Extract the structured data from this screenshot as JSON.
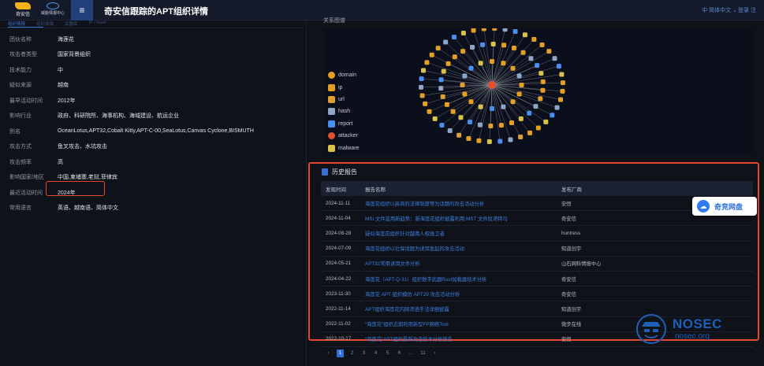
{
  "header": {
    "logo1_text": "奇安信",
    "logo2_text": "威胁情报中心",
    "menu_icon": "≡",
    "title": "奇安信跟踪的APT组织详情",
    "language": "中 简体中文 ⌄",
    "login": "登录 注"
  },
  "tabs": [
    "组织情报",
    "组织画像",
    "武器库",
    "IP / Hash"
  ],
  "profile": {
    "rows": [
      {
        "label": "团伙名称",
        "value": "海莲花"
      },
      {
        "label": "攻击者类型",
        "value": "国家背景组织"
      },
      {
        "label": "技术能力",
        "value": "中"
      },
      {
        "label": "疑似来源",
        "value": "越南"
      },
      {
        "label": "最早活动时间",
        "value": "2012年"
      },
      {
        "label": "影响行业",
        "value": "政府、科研院所、海事机构、海域建设、航运企业"
      },
      {
        "label": "别名",
        "value": "OceanLotus,APT32,Cobalt Kitty,APT-C-00,SeaLotus,Canvas Cyclone,BISMUTH"
      },
      {
        "label": "攻击方式",
        "value": "鱼叉攻击、水坑攻击"
      },
      {
        "label": "攻击频率",
        "value": "高"
      },
      {
        "label": "影响国家/地区",
        "value": "中国,柬埔寨,老挝,菲律宾"
      },
      {
        "label": "最近活动时间",
        "value": "2024年"
      },
      {
        "label": "常用语言",
        "value": "英语、越南语、简体中文"
      }
    ]
  },
  "graph": {
    "title": "关系图谱",
    "legend": [
      {
        "icon": "domain-icon",
        "color": "#e5a023",
        "label": "domain"
      },
      {
        "icon": "ip-icon",
        "color": "#e5a023",
        "label": "ip"
      },
      {
        "icon": "url-icon",
        "color": "#e0a030",
        "label": "url"
      },
      {
        "icon": "hash-icon",
        "color": "#8fa6c8",
        "label": "hash"
      },
      {
        "icon": "report-icon",
        "color": "#4a8ff0",
        "label": "report"
      },
      {
        "icon": "attacker-icon",
        "color": "#e2502f",
        "label": "attacker"
      },
      {
        "icon": "malware-icon",
        "color": "#d8c24a",
        "label": "malware"
      }
    ]
  },
  "history": {
    "title": "历史报告",
    "columns": [
      "发现时间",
      "报告名称",
      "发布厂商"
    ],
    "rows": [
      {
        "date": "2024-11-11",
        "name": "海莲花组织以高商的法律制度等为话题的攻击活动分析",
        "publisher": "安恒"
      },
      {
        "date": "2024-11-04",
        "name": "MSI 文件滥用新趋势：新海莲花组织披露利用 MST 文件投递特马",
        "publisher": "奇安信"
      },
      {
        "date": "2024-08-28",
        "name": "疑似海莲花组织针对越南人权维卫者",
        "publisher": "huntress"
      },
      {
        "date": "2024-07-09",
        "name": "海莲花组织以社保话题为诱饵发起的攻击活动",
        "publisher": "知道创宇"
      },
      {
        "date": "2024-05-21",
        "name": "APT32常用诱饵文件分析",
        "publisher": "山石网科情报中心"
      },
      {
        "date": "2024-04-22",
        "name": "海莲花（APT-Q-31）组织数字武器Rust加载器技术分析",
        "publisher": "奇安信"
      },
      {
        "date": "2023-11-30",
        "name": "海莲花 APT 组织模仿 APT29 攻击活动分析",
        "publisher": "奇安信"
      },
      {
        "date": "2022-11-14",
        "name": "APT组织海莲花内网渗透手法详细披露",
        "publisher": "知道创宇"
      },
      {
        "date": "2022-11-02",
        "name": "“海莲花”组织近期利用新型FP网络Tool",
        "publisher": "微步在线"
      },
      {
        "date": "2022-10-17",
        "name": "“海莲花”APT组织最新攻击技术分析报告",
        "publisher": "安恒"
      }
    ]
  },
  "pagination": {
    "prev": "‹",
    "pages": [
      "1",
      "2",
      "3",
      "4",
      "5",
      "6",
      "...",
      "11"
    ],
    "next": "›",
    "current": "1"
  },
  "floating": {
    "label": "奇竞网盘"
  },
  "watermark": {
    "brand": "NOSEC",
    "sub": "nosec.org"
  }
}
